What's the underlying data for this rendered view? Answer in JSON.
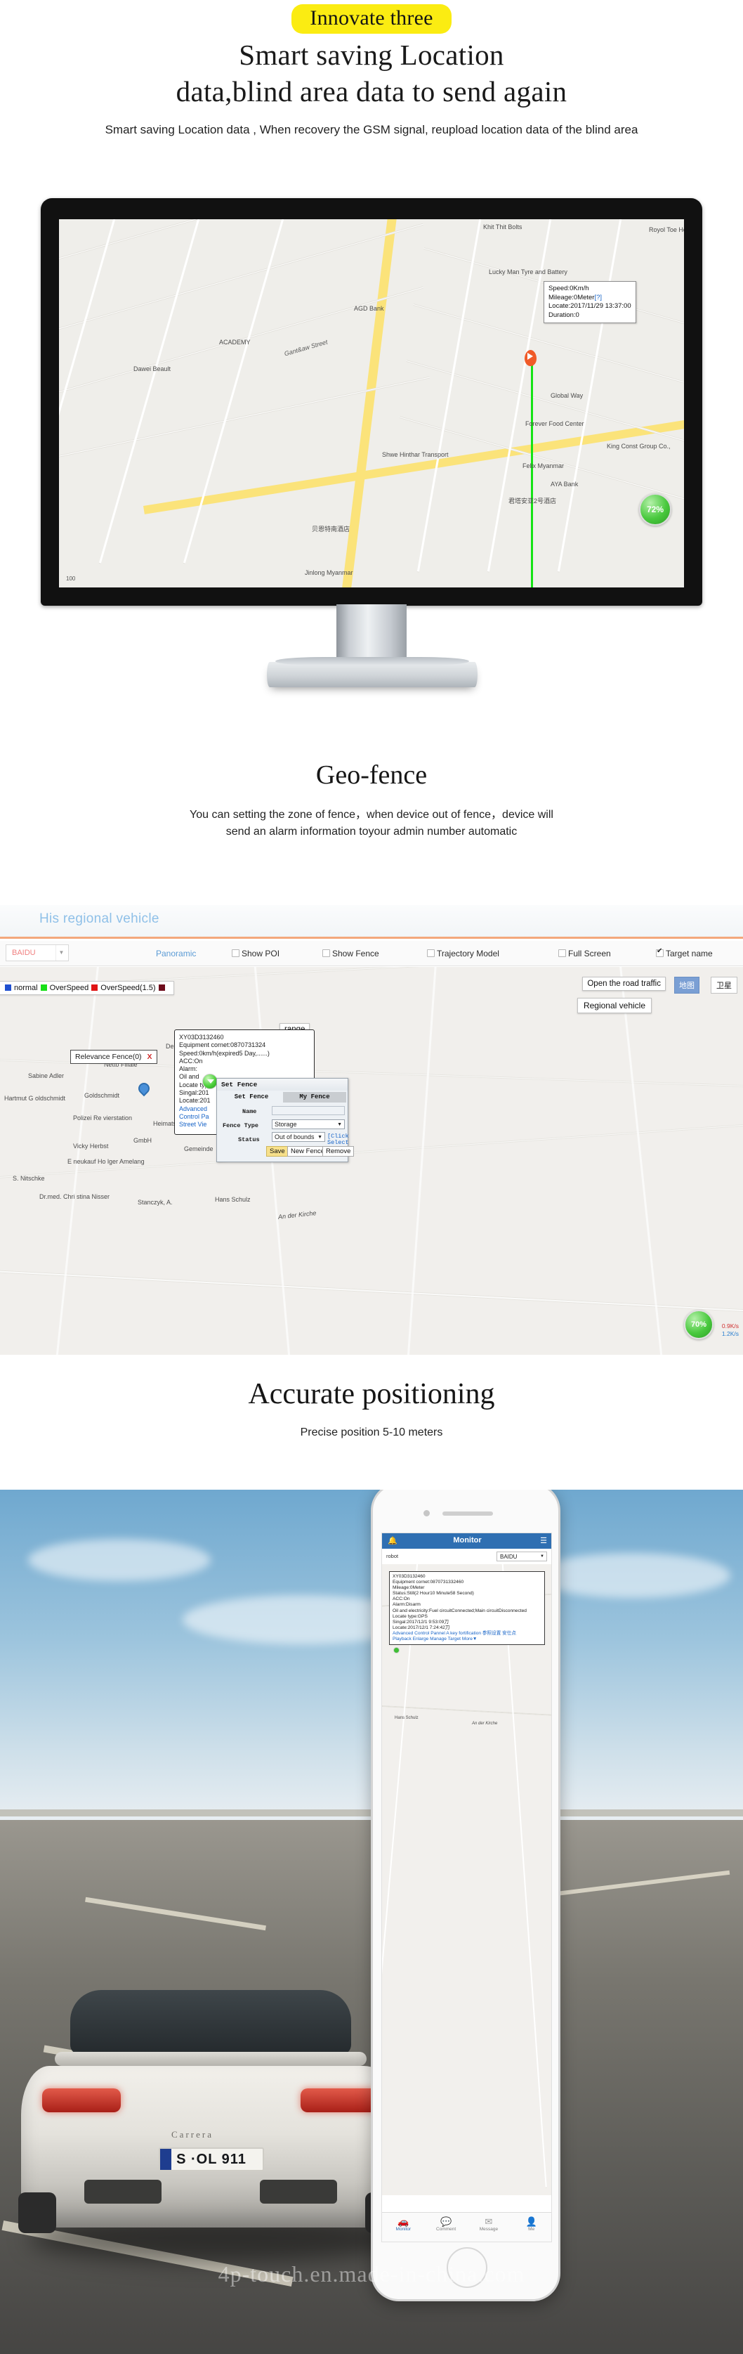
{
  "header": {
    "badge": "Innovate three",
    "title_line1": "Smart saving Location",
    "title_line2": "data,blind area data to send again",
    "subtitle": "Smart saving Location data , When recovery the GSM signal, reupload location data of the blind area"
  },
  "monitor_map": {
    "bubble": {
      "speed": "Speed:0Km/h",
      "mileage": "Mileage:0Meter",
      "mileage_flag": "[?]",
      "locate": "Locate:2017/11/29 13:37:00",
      "duration": "Duration:0"
    },
    "battery_gauge": "72%",
    "scale": "100",
    "pois": [
      "Khit Thit Bolts",
      "Royol Toe Hot",
      "Lucky Man Tyre and Battery",
      "AGD Bank",
      "ACADEMY",
      "Dawei Beault",
      "Gant&aw Street",
      "Global Way",
      "Forever Food Center",
      "King Const Group Co.,",
      "Shwe Hinthar Transport",
      "Felix Myanmar",
      "AYA Bank",
      "君塔安亚2号酒店",
      "贝恩特南酒店",
      "Jinlong Myanmar"
    ]
  },
  "geofence": {
    "title": "Geo-fence",
    "desc_line1": "You can setting the zone of fence，when device out of fence，device will",
    "desc_line2": "send an alarm information toyour admin number automatic"
  },
  "webapp": {
    "tab_label": "His regional vehicle",
    "map_provider": "BAIDU",
    "panoramic_link": "Panoramic",
    "checkboxes": [
      {
        "label": "Show POI",
        "checked": false
      },
      {
        "label": "Show Fence",
        "checked": false
      },
      {
        "label": "Trajectory Model",
        "checked": false
      },
      {
        "label": "Full Screen",
        "checked": false
      },
      {
        "label": "Target name",
        "checked": true
      }
    ],
    "legend": {
      "normal_label": "normal",
      "normal_color": "#2050d0",
      "overspeed_label": "OverSpeed",
      "overspeed_color": "#17e017",
      "overspeed15_label": "OverSpeed(1.5)",
      "overspeed15_color": "#e01414",
      "last_color": "#6e0c1c"
    },
    "btn_open_road_traffic": "Open the road traffic",
    "btn_map": "地图",
    "btn_satellite": "卫星",
    "btn_regional_vehicle": "Regional vehicle",
    "btn_range": "range",
    "fence_box_label": "Relevance Fence(0)",
    "fence_box_close": "X",
    "info_card": {
      "id": "XY03D3132460",
      "cornet": "Equipment cornet:0870731324",
      "speed": "Speed:0km/h(expired5 Day,......)",
      "acc": "ACC:On",
      "alarm": "Alarm:",
      "oil": "Oil and",
      "locate_type": "Locate typ",
      "singal": "Singal:201",
      "locate": "Locate:201",
      "link1": "Advanced",
      "link2": "Control Pa",
      "link3": "Street Vie"
    },
    "dialog": {
      "title": "Set Fence",
      "tab_active": "Set Fence",
      "tab_inactive": "My Fence",
      "name_label": "Name",
      "name_value": "",
      "fence_type_label": "Fence Type",
      "fence_type_value": "Storage",
      "status_label": "Status",
      "status_value": "Out of bounds",
      "select_bind": "[Click Select Bind]",
      "btn_save": "Save",
      "btn_new_fence": "New Fence",
      "btn_remove": "Remove"
    },
    "gauge": "70%",
    "net_up": "0.9K/s",
    "net_down": "1.2K/s",
    "map_pois": [
      "Deutsche P ost Filiale",
      "Netto Filiale",
      "Sabine Adler",
      "Goldschmidt",
      "Hartmut G oldschmidt",
      "Polizei Re vierstation",
      "Heimatstube",
      "GmbH",
      "Vicky Herbst",
      "E neukauf Ho lger Amelang",
      "S. Nitschke",
      "Dr.med. Chri stina Nisser",
      "Stanczyk, A.",
      "Hans Schulz",
      "An der Kirche",
      "Gemeinde"
    ]
  },
  "accurate": {
    "title": "Accurate positioning",
    "subtitle": "Precise position 5-10 meters"
  },
  "phone_app": {
    "title": "Monitor",
    "bell_icon": "bell-icon",
    "menu_icon": "menu-icon",
    "robot_label": "robot",
    "provider": "BAIDU",
    "card": {
      "id": "XY03D3132460",
      "cornet": "Equipment cornet:0870731332460",
      "mileage": "Mileage:0Meter",
      "status": "Status:Still(2 Hour10 Minute58 Second)",
      "acc": "ACC:On",
      "alarm": "Alarm:Disarm",
      "oil": "Oil and electricity:Fuel circuitConnected;Main circuitDisconnected",
      "locate_type": "Locate type:GPS",
      "singal": "Singal:2017/12/1 9:53:09刀",
      "locate": "Locate:2017/12/1 7:24:42刀",
      "links1": "Advanced  Control Pannel A key fortification  参照设置  安仕点",
      "links2": "Playback Enlarge  Manage Target More▼"
    },
    "map_poi1": "Hans Schulz",
    "map_poi2": "An der Kirche",
    "nav": [
      {
        "icon": "car-icon",
        "label": "Monitor",
        "active": true
      },
      {
        "icon": "comment-icon",
        "label": "Comment",
        "active": false
      },
      {
        "icon": "message-icon",
        "label": "Message",
        "active": false
      },
      {
        "icon": "user-icon",
        "label": "Me",
        "active": false
      }
    ]
  },
  "watermark": "4p-touch.en.made-in-china.com"
}
